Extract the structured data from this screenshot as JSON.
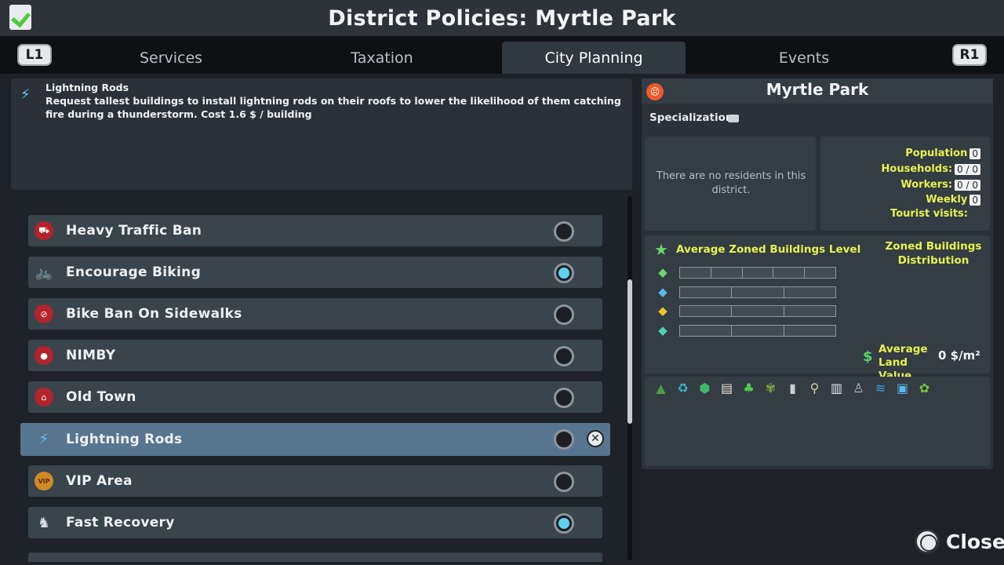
{
  "title": "District Policies: Myrtle Park",
  "tabs": {
    "left_shoulder": "L1",
    "right_shoulder": "R1",
    "items": [
      "Services",
      "Taxation",
      "City Planning",
      "Events"
    ],
    "active": "City Planning"
  },
  "description": {
    "title": "Lightning Rods",
    "text": "Request tallest buildings to install lightning rods on their roofs to lower the likelihood of them catching fire during a thunderstorm. Cost 1.6 $ / building"
  },
  "policies": [
    {
      "label": "Heavy Traffic Ban",
      "icon": "no-truck-icon",
      "enabled": false
    },
    {
      "label": "Encourage Biking",
      "icon": "bike-icon",
      "enabled": true
    },
    {
      "label": "Bike Ban On Sidewalks",
      "icon": "no-bike-icon",
      "enabled": false
    },
    {
      "label": "NIMBY",
      "icon": "nimby-icon",
      "enabled": false
    },
    {
      "label": "Old Town",
      "icon": "old-town-icon",
      "enabled": false
    },
    {
      "label": "Lightning Rods",
      "icon": "lightning-icon",
      "enabled": false,
      "selected": true
    },
    {
      "label": "VIP Area",
      "icon": "vip-icon",
      "enabled": false
    },
    {
      "label": "Fast Recovery",
      "icon": "fast-recovery-icon",
      "enabled": true
    }
  ],
  "district": {
    "name": "Myrtle Park",
    "specializations_label": "Specializations",
    "no_residents": "There are no residents in this district.",
    "stats": [
      {
        "label": "Population",
        "value": "0"
      },
      {
        "label": "Households:",
        "value": "0 / 0"
      },
      {
        "label": "Workers:",
        "value": "0 / 0"
      },
      {
        "label": "Weekly",
        "value": "0"
      },
      {
        "label": "Tourist visits:",
        "value": ""
      }
    ],
    "avg_zoned_label": "Average Zoned Buildings Level",
    "zoned_dist_label": "Zoned Buildings Distribution",
    "avg_land_label": "Average Land Value",
    "avg_land_value": "0 $/m²"
  },
  "close_label": "Close",
  "colors": {
    "accent_yellow": "#e7f34c",
    "radio_on": "#5fd0f0",
    "selected_row": "#587590"
  }
}
